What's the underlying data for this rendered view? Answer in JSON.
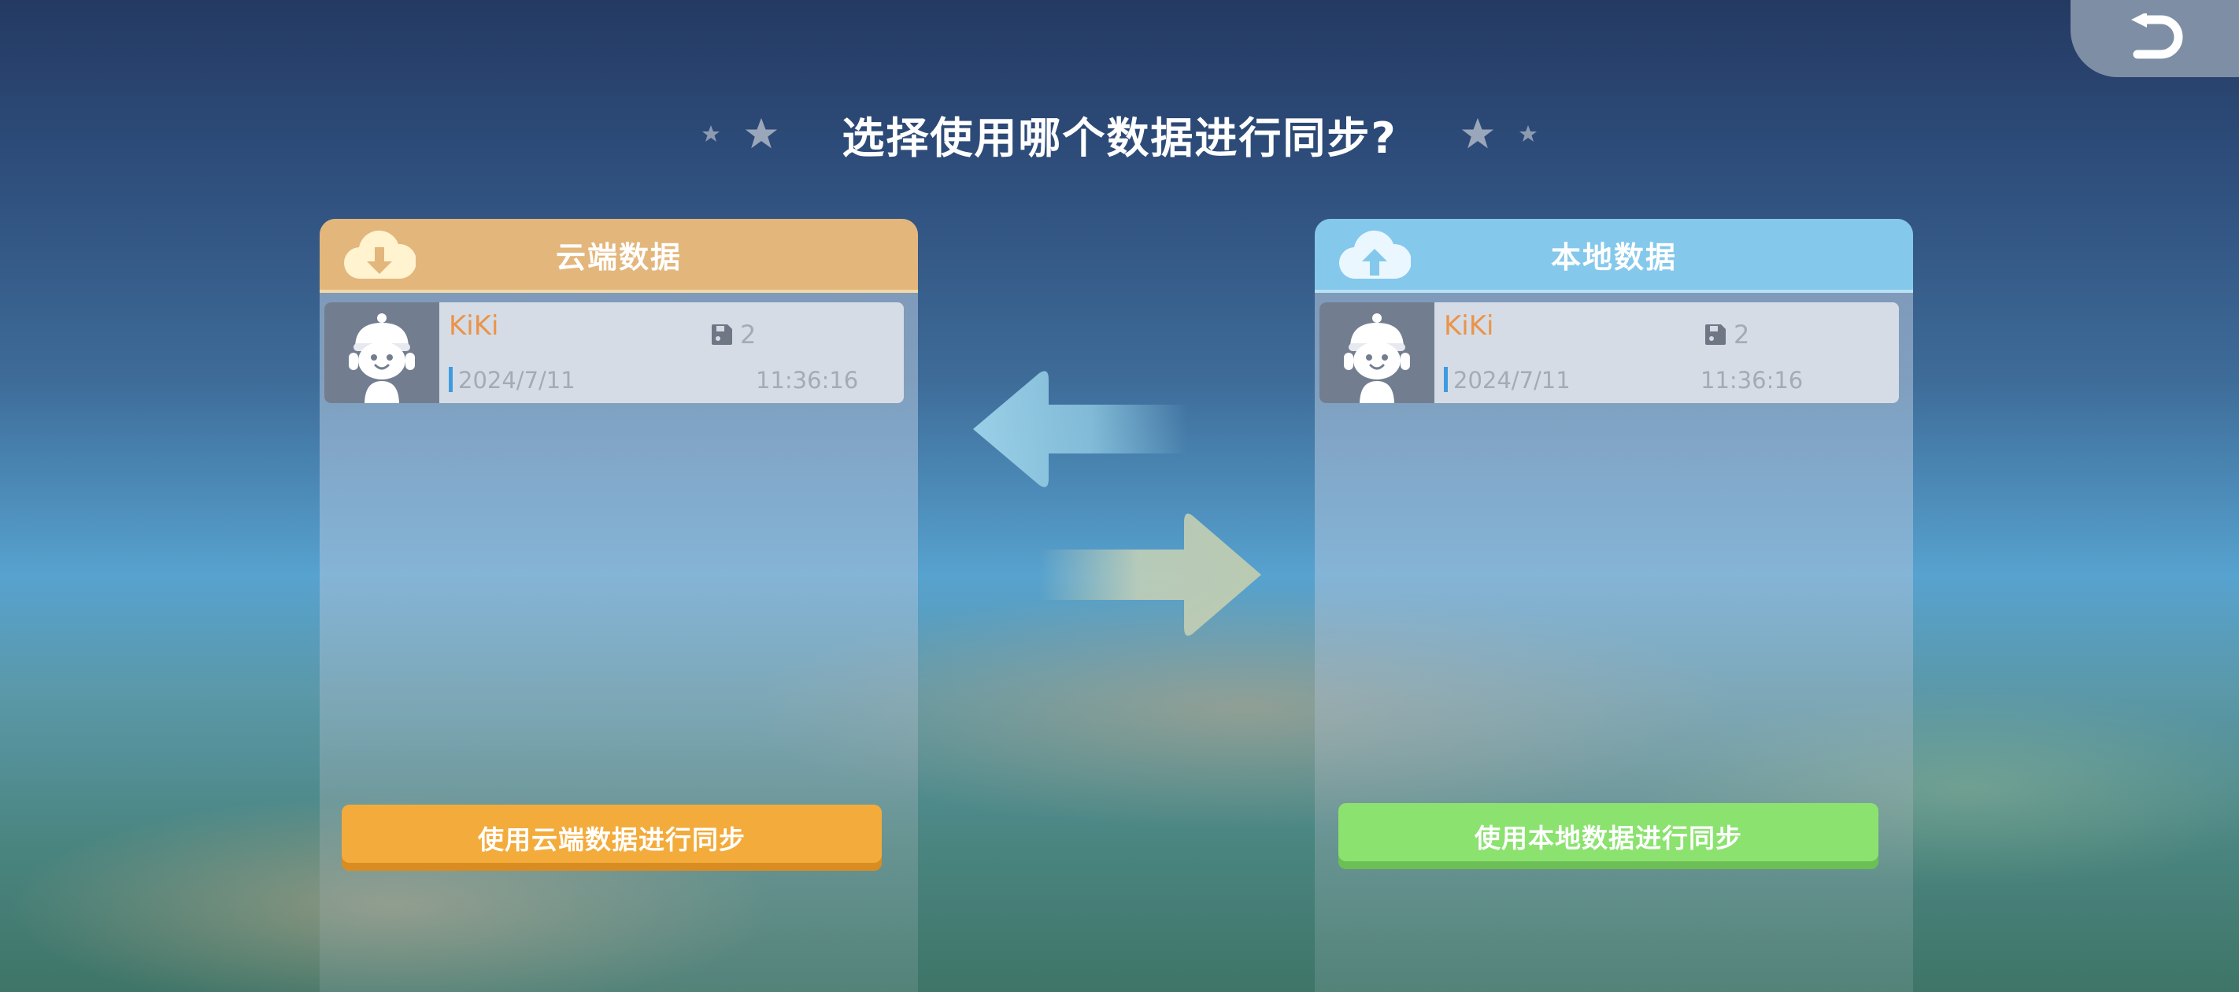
{
  "title": "选择使用哪个数据进行同步?",
  "back_button": {
    "icon": "return-arrow-icon"
  },
  "cloud_panel": {
    "header_title": "云端数据",
    "header_icon": "cloud-download-icon",
    "save": {
      "player_name": "KiKi",
      "slot_icon": "save-slot-icon",
      "slot_number": "2",
      "date": "2024/7/11",
      "time": "11:36:16"
    },
    "button_label": "使用云端数据进行同步"
  },
  "local_panel": {
    "header_title": "本地数据",
    "header_icon": "cloud-upload-icon",
    "save": {
      "player_name": "KiKi",
      "slot_icon": "save-slot-icon",
      "slot_number": "2",
      "date": "2024/7/11",
      "time": "11:36:16"
    },
    "button_label": "使用本地数据进行同步"
  },
  "colors": {
    "cloud_accent": "#e3b67c",
    "cloud_button": "#f3ab3b",
    "local_accent": "#84c8ec",
    "local_button": "#8be26f",
    "player_name": "#e9944a"
  }
}
